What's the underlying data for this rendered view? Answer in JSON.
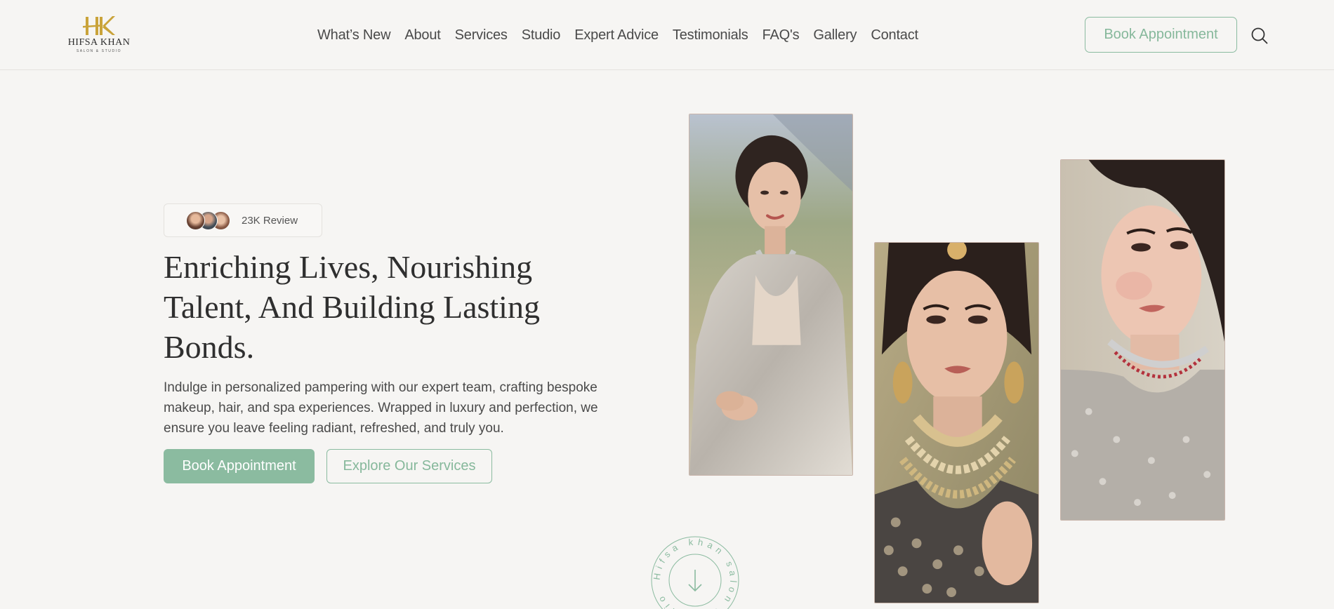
{
  "brand": {
    "logo_mark": "HK",
    "name": "HIFSA KHAN",
    "tagline": "SALON & STUDIO",
    "gold": "#c9a33a"
  },
  "nav": {
    "items": [
      {
        "label": "What’s New"
      },
      {
        "label": "About"
      },
      {
        "label": "Services"
      },
      {
        "label": "Studio"
      },
      {
        "label": "Expert Advice"
      },
      {
        "label": "Testimonials"
      },
      {
        "label": "FAQ's"
      },
      {
        "label": "Gallery"
      },
      {
        "label": "Contact"
      }
    ],
    "book_label": "Book Appointment",
    "search_icon": "search-icon"
  },
  "hero": {
    "review_text": "23K Review",
    "title": "Enriching Lives, Nourishing Talent, And Building Lasting Bonds.",
    "description": "Indulge in personalized pampering with our expert team, crafting bespoke makeup, hair, and spa experiences. Wrapped in luxury and perfection, we ensure you leave feeling radiant, refreshed, and truly you.",
    "primary_button": "Book Appointment",
    "secondary_button": "Explore Our Services"
  },
  "scroll_badge": {
    "circular_text": "Hifsa khan salon & studio",
    "icon": "arrow-down-icon"
  },
  "colors": {
    "accent": "#8bbba0",
    "background": "#f6f5f3",
    "text": "#3b3b3b"
  }
}
